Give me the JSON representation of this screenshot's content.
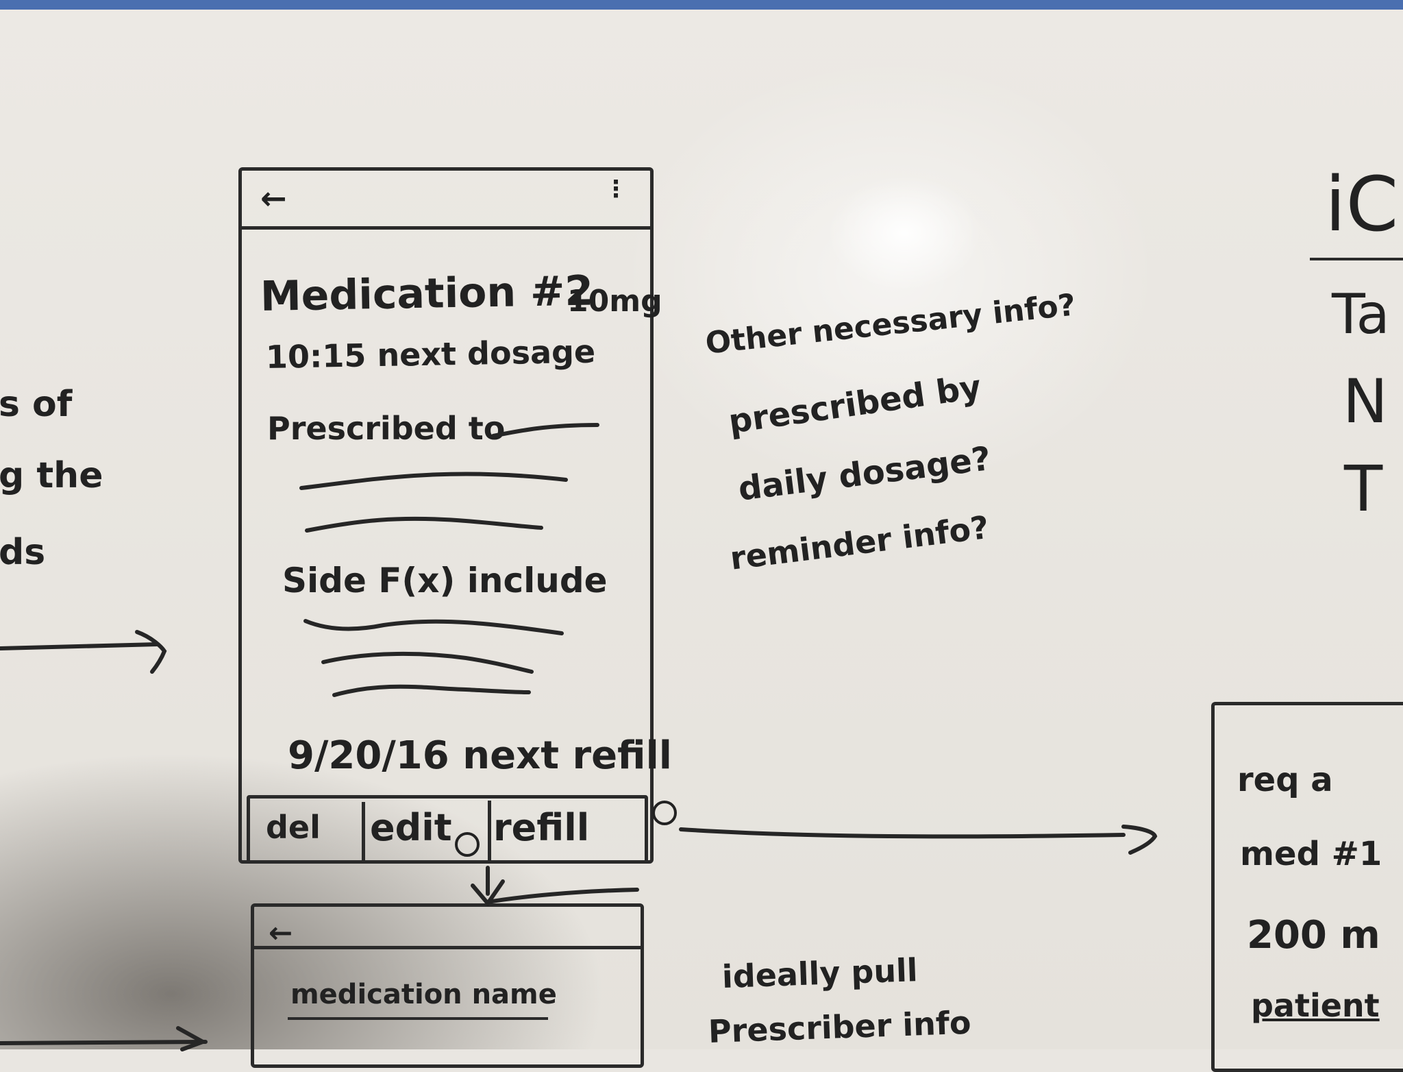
{
  "main_screen": {
    "back_icon": "back-arrow-icon",
    "title": "Medication #2",
    "dose": "10mg",
    "next_dosage": "10:15 next dosage",
    "prescribed_to": "Prescribed to",
    "side_effects": "Side F(x) include",
    "next_refill": "9/20/16 next refill",
    "actions": {
      "del": "del",
      "edit": "edit",
      "refill": "refill"
    }
  },
  "side_notes": {
    "line1": "Other necessary info?",
    "line2": "prescribed by",
    "line3": "daily dosage?",
    "line4": "reminder info?"
  },
  "left_fragments": {
    "line1": "s of",
    "line2": "g the",
    "line3": "ds"
  },
  "bottom_screen": {
    "back_icon": "back-arrow-icon",
    "field": "medication name"
  },
  "bottom_notes": {
    "line1": "ideally pull",
    "line2": "Prescriber info"
  },
  "right_screen": {
    "line1": "req a",
    "line2": "med #1",
    "line3": "200 m",
    "line4": "patient"
  },
  "right_top_fragments": {
    "line1": "iC",
    "line2": "Ta",
    "line3": "N",
    "line4": "T"
  }
}
